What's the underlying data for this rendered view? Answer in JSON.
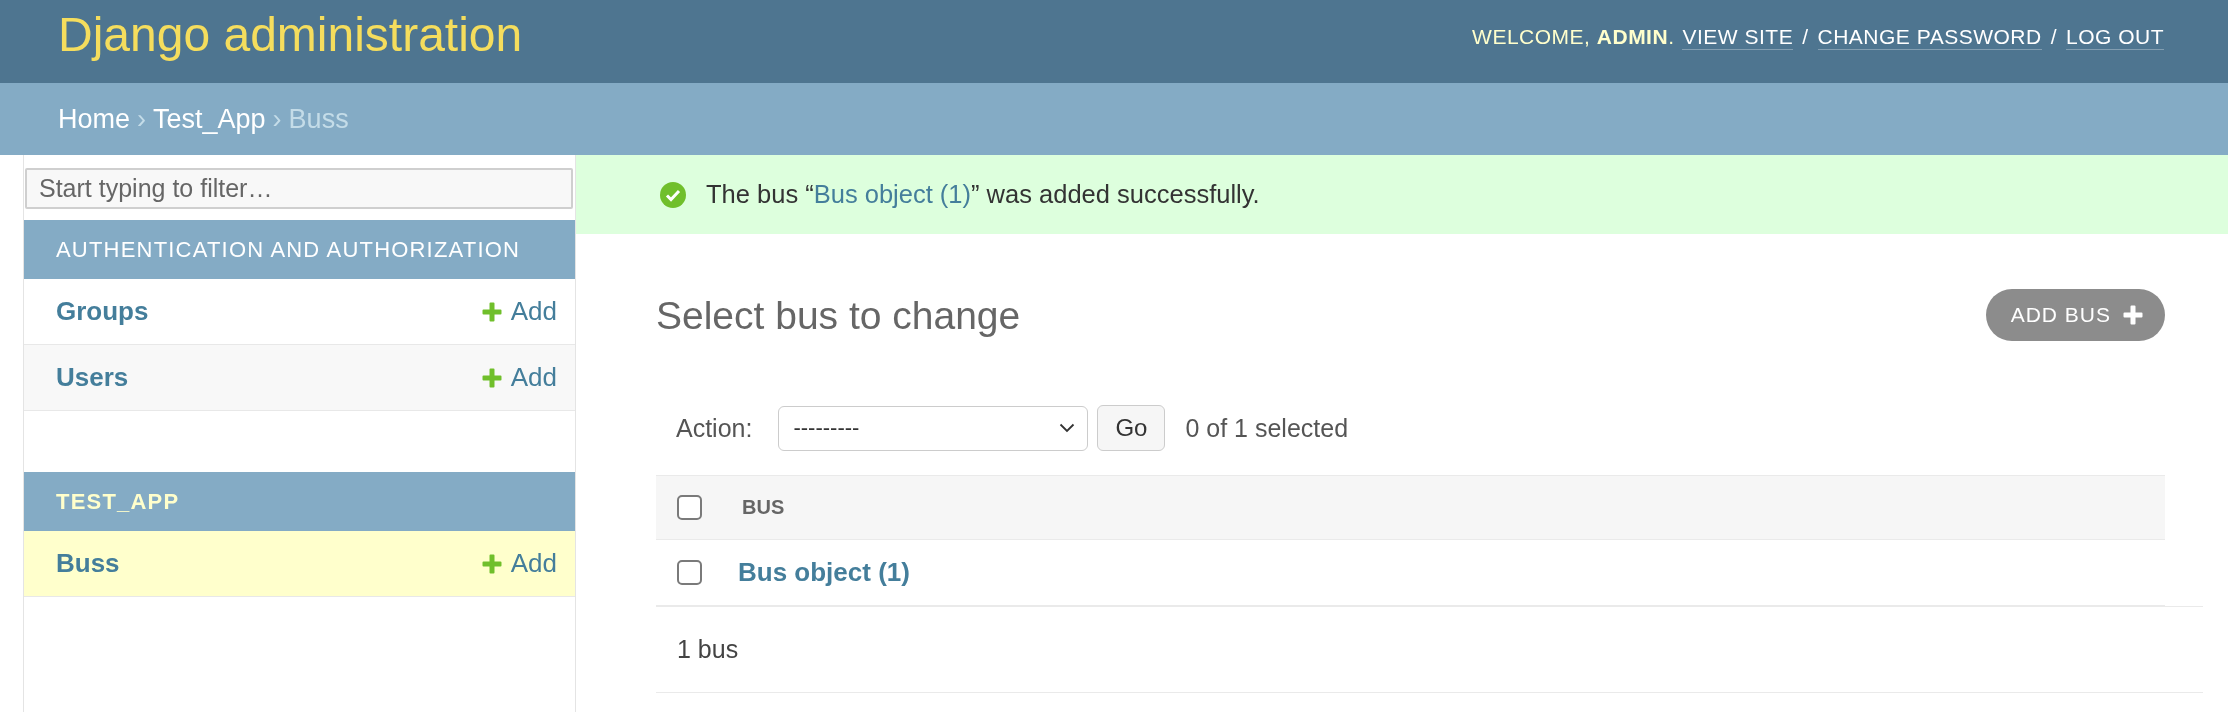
{
  "header": {
    "site_name": "Django administration",
    "user_tools": {
      "welcome": "WELCOME, **ADMIN**.",
      "links": [
        "VIEW SITE",
        "CHANGE PASSWORD",
        "LOG OUT"
      ],
      "separators": [
        "/",
        "/"
      ]
    }
  },
  "breadcrumbs": {
    "items": [
      {
        "label": "Home",
        "current": false
      },
      {
        "label": "Test_App",
        "current": false
      },
      {
        "label": "Buss",
        "current": true
      }
    ],
    "separators": [
      "›",
      "›"
    ]
  },
  "sidebar": {
    "filter": {
      "placeholder": "Start typing to filter…"
    },
    "apps": [
      {
        "name": "AUTHENTICATION AND AUTHORIZATION",
        "selected": false,
        "models": [
          {
            "name": "Groups",
            "add": "Add",
            "selected": false
          },
          {
            "name": "Users",
            "add": "Add",
            "selected": false
          }
        ]
      },
      {
        "name": "TEST_APP",
        "selected": true,
        "models": [
          {
            "name": "Buss",
            "add": "Add",
            "selected": true
          }
        ]
      }
    ]
  },
  "message": {
    "kind": "success",
    "prefix": "The bus “",
    "link": "Bus object (1)",
    "suffix": "” was added successfully."
  },
  "content": {
    "title": "Select bus to change",
    "add_button": "ADD BUS",
    "actions": {
      "label": "Action:",
      "value": "---------",
      "go": "Go",
      "counter": "0 of 1 selected"
    },
    "table": {
      "select_all": {
        "checked": false
      },
      "columns": [
        "BUS"
      ],
      "rows": [
        {
          "checked": false,
          "cells": [
            "Bus object (1)"
          ]
        }
      ]
    },
    "paginator": "1 bus"
  }
}
